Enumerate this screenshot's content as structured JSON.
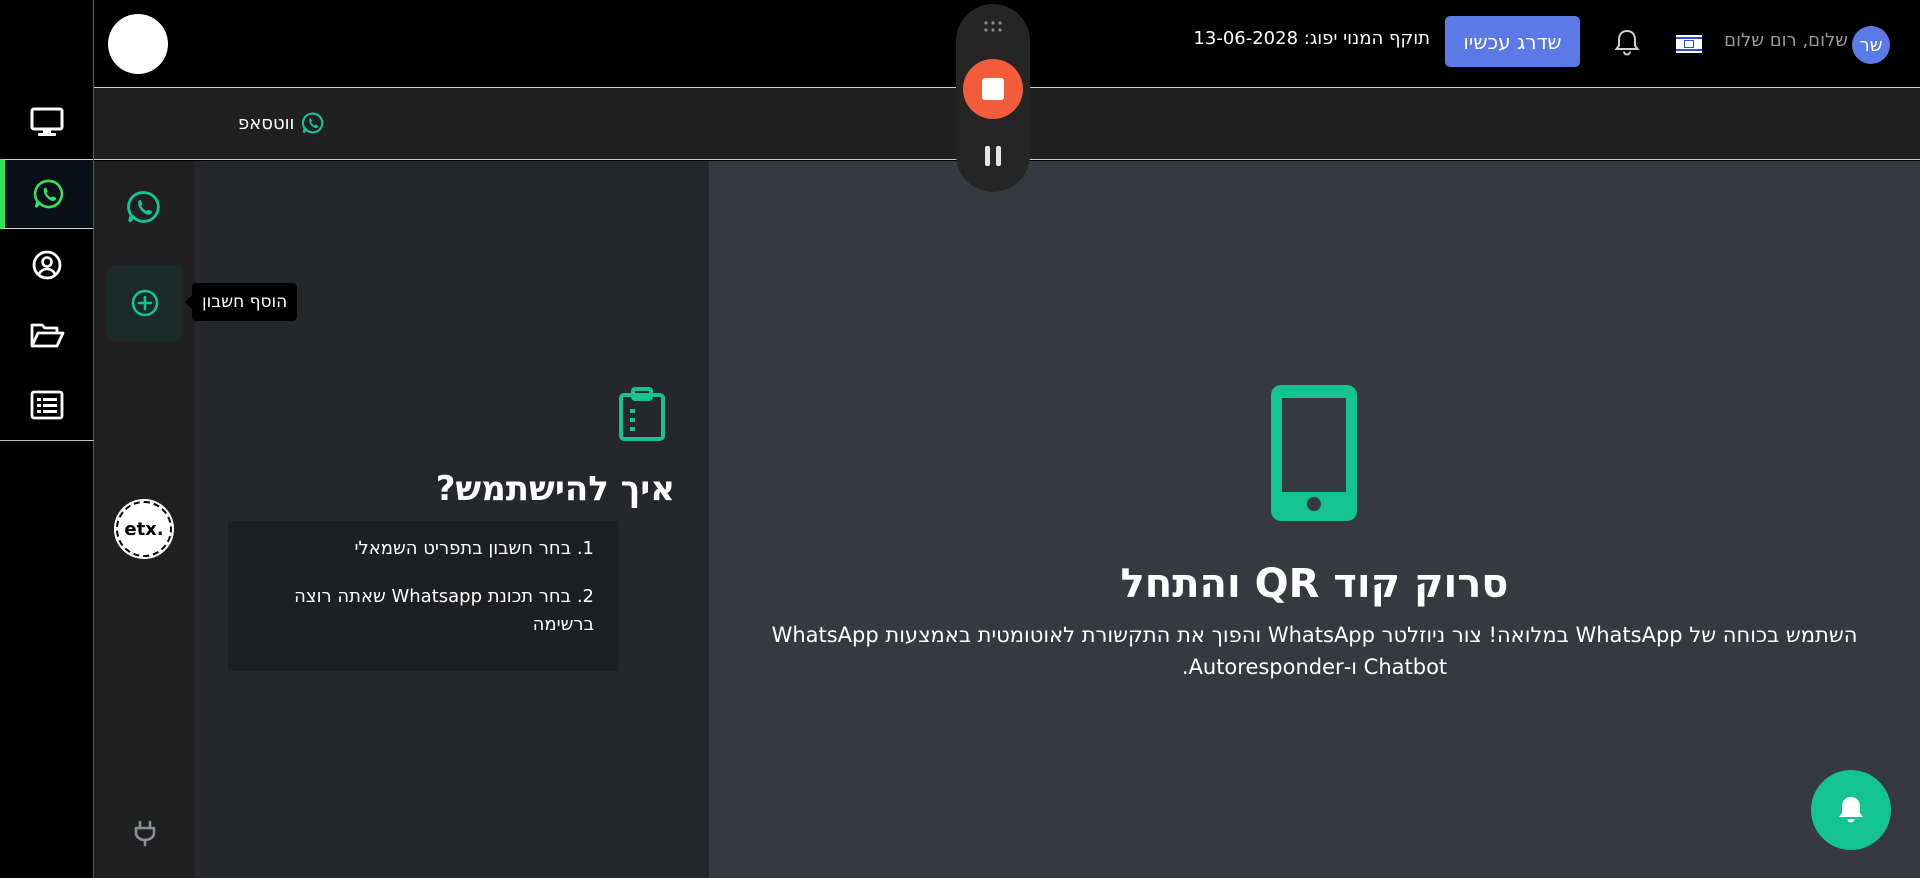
{
  "colors": {
    "accent_green": "#13c491",
    "upgrade_blue": "#5b7ae8",
    "record_red": "#f25c3b",
    "nav_active": "#2ee65a"
  },
  "sidebar": {
    "items": [
      {
        "icon": "monitor-icon"
      },
      {
        "icon": "whatsapp-icon",
        "active": true
      },
      {
        "icon": "user-circle-icon"
      },
      {
        "icon": "folder-open-icon"
      },
      {
        "icon": "list-icon"
      }
    ]
  },
  "header": {
    "expiry_label": "תוקף המנוי יפוג: 13-06-2028",
    "upgrade_label": "שדרג עכשיו",
    "greeting": "שלום, רום שלום",
    "avatar_initials": "שר"
  },
  "subheader": {
    "title": "ווטסאפ"
  },
  "accounts": {
    "add_tooltip": "הוסף חשבון",
    "account_logo_text": "etx."
  },
  "howto": {
    "title": "איך להישתמש?",
    "steps": [
      "1. בחר חשבון בתפריט השמאלי",
      "2. בחר תכונת Whatsapp שאתה רוצה ברשימה"
    ]
  },
  "main": {
    "title": "סרוק קוד QR והתחל",
    "description": "השתמש בכוחה של WhatsApp במלואה! צור ניוזלטר WhatsApp והפוך את התקשורת לאוטומטית באמצעות WhatsApp Chatbot ו-Autoresponder."
  }
}
